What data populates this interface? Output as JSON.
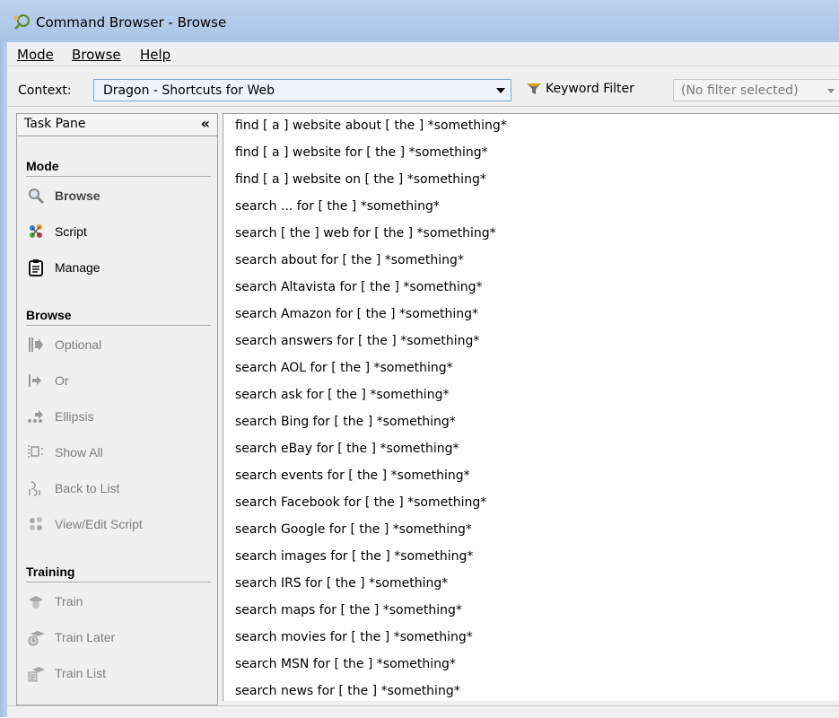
{
  "window": {
    "title": "Command Browser - Browse"
  },
  "menu": [
    {
      "label": "Mode"
    },
    {
      "label": "Browse"
    },
    {
      "label": "Help"
    }
  ],
  "context": {
    "label": "Context:",
    "value": "Dragon - Shortcuts for Web",
    "keyword_filter_label": "Keyword Filter",
    "keyword_filter_value": "(No filter selected)"
  },
  "task_pane": {
    "title": "Task Pane",
    "collapse_glyph": "«",
    "sections": {
      "mode": {
        "title": "Mode",
        "items": [
          {
            "label": "Browse",
            "icon": "magnifier-icon"
          },
          {
            "label": "Script",
            "icon": "script-icon"
          },
          {
            "label": "Manage",
            "icon": "clipboard-icon"
          }
        ]
      },
      "browse": {
        "title": "Browse",
        "items": [
          {
            "label": "Optional",
            "icon": "optional-icon"
          },
          {
            "label": "Or",
            "icon": "or-icon"
          },
          {
            "label": "Ellipsis",
            "icon": "ellipsis-icon"
          },
          {
            "label": "Show All",
            "icon": "show-all-icon"
          },
          {
            "label": "Back to List",
            "icon": "back-to-list-icon"
          },
          {
            "label": "View/Edit Script",
            "icon": "view-edit-script-icon"
          }
        ]
      },
      "training": {
        "title": "Training",
        "items": [
          {
            "label": "Train",
            "icon": "train-icon"
          },
          {
            "label": "Train Later",
            "icon": "train-later-icon"
          },
          {
            "label": "Train List",
            "icon": "train-list-icon"
          }
        ]
      }
    }
  },
  "commands": [
    "find [ a ] website about [ the ] *something*",
    "find [ a ] website for [ the ] *something*",
    "find [ a ] website on [ the ] *something*",
    "search ... for [ the ] *something*",
    "search [ the ] web for [ the ] *something*",
    "search about for [ the ] *something*",
    "search Altavista for [ the ] *something*",
    "search Amazon for [ the ] *something*",
    "search answers for [ the ] *something*",
    "search AOL for [ the ] *something*",
    "search ask for [ the ] *something*",
    "search Bing for [ the ] *something*",
    "search eBay for [ the ] *something*",
    "search events for [ the ] *something*",
    "search Facebook for [ the ] *something*",
    "search Google for [ the ] *something*",
    "search images for [ the ] *something*",
    "search IRS for [ the ] *something*",
    "search maps for [ the ] *something*",
    "search movies for [ the ] *something*",
    "search MSN for [ the ] *something*",
    "search news for [ the ] *something*"
  ]
}
